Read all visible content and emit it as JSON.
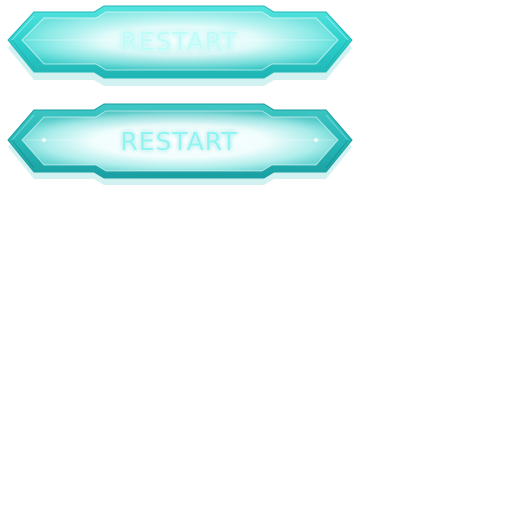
{
  "buttons": [
    {
      "state": "normal",
      "label": "RESTART"
    },
    {
      "state": "highlighted",
      "label": "RESTART"
    }
  ],
  "colors": {
    "accent": "#2fd6d0",
    "accent_dark": "#1aaab0",
    "glow": "#e6fffe"
  }
}
